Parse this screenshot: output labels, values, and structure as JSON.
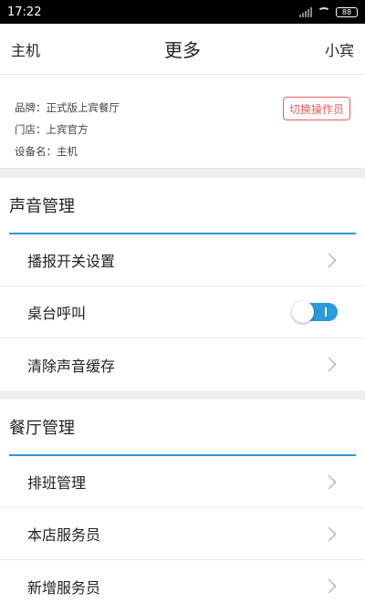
{
  "status_bar": {
    "time": "17:22",
    "battery": "88"
  },
  "header": {
    "left": "主机",
    "title": "更多",
    "right": "小宾"
  },
  "info": {
    "brand": "品牌：正式版上宾餐厅",
    "store": "门店：上宾官方",
    "device": "设备名：主机",
    "switch_label": "切换操作员"
  },
  "sound_section": {
    "title": "声音管理",
    "items": [
      {
        "label": "播报开关设置"
      },
      {
        "label": "桌台呼叫",
        "toggle_on": true
      },
      {
        "label": "清除声音缓存"
      }
    ]
  },
  "restaurant_section": {
    "title": "餐厅管理",
    "items": [
      {
        "label": "排班管理"
      },
      {
        "label": "本店服务员"
      },
      {
        "label": "新增服务员"
      }
    ]
  },
  "colors": {
    "accent": "#2b9bdc",
    "danger": "#ee5a5a"
  }
}
